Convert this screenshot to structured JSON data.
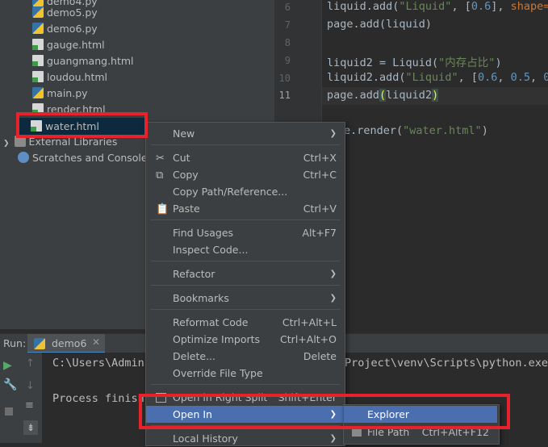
{
  "tree": {
    "items": [
      {
        "label": "demo4.py",
        "icon": "python-file-icon"
      },
      {
        "label": "demo5.py",
        "icon": "python-file-icon"
      },
      {
        "label": "demo6.py",
        "icon": "python-file-icon"
      },
      {
        "label": "gauge.html",
        "icon": "html-file-icon"
      },
      {
        "label": "guangmang.html",
        "icon": "html-file-icon"
      },
      {
        "label": "loudou.html",
        "icon": "html-file-icon"
      },
      {
        "label": "main.py",
        "icon": "python-file-icon"
      },
      {
        "label": "render.html",
        "icon": "html-file-icon"
      },
      {
        "label": "water.html",
        "icon": "html-file-icon"
      }
    ],
    "external_libraries": "External Libraries",
    "scratches": "Scratches and Consoles"
  },
  "editor": {
    "line_numbers": [
      "6",
      "7",
      "8",
      "9",
      "10",
      "11"
    ],
    "current_line": "11",
    "code": {
      "l6a": "liquid.add(",
      "l6s": "\"Liquid\"",
      "l6b": ", [",
      "l6n": "0.6",
      "l6c": "], ",
      "l6k": "shape=",
      "l7": "page.add(liquid)",
      "l9a": "liquid2 = Liquid(",
      "l9s": "\"内存占比\"",
      "l9b": ")",
      "l10a": "liquid2.add(",
      "l10s": "\"Liquid\"",
      "l10b": ", [",
      "l10n1": "0.6",
      "l10c": ", ",
      "l10n2": "0.5",
      "l10d": ", ",
      "l10n3": "0",
      "l11a": "page.add",
      "l11p": "(",
      "l11b": "liquid2",
      "l11q": ")",
      "l13a": "e.render(",
      "l13s": "\"water.html\"",
      "l13b": ")"
    }
  },
  "run": {
    "label": "Run:",
    "tab": "demo6",
    "line1_left": "C:\\Users\\Admin",
    "line1_right": "Project\\venv\\Scripts\\python.exe",
    "line2": "Process finish"
  },
  "context_menu": {
    "items": [
      {
        "label": "New",
        "shortcut": "",
        "submenu": true
      },
      {
        "label": "Cut",
        "shortcut": "Ctrl+X",
        "icon": "scissors-icon"
      },
      {
        "label": "Copy",
        "shortcut": "Ctrl+C",
        "icon": "copy-icon"
      },
      {
        "label": "Copy Path/Reference...",
        "shortcut": ""
      },
      {
        "label": "Paste",
        "shortcut": "Ctrl+V",
        "icon": "paste-icon"
      },
      {
        "label": "Find Usages",
        "shortcut": "Alt+F7"
      },
      {
        "label": "Inspect Code...",
        "shortcut": ""
      },
      {
        "label": "Refactor",
        "shortcut": "",
        "submenu": true
      },
      {
        "label": "Bookmarks",
        "shortcut": "",
        "submenu": true
      },
      {
        "label": "Reformat Code",
        "shortcut": "Ctrl+Alt+L"
      },
      {
        "label": "Optimize Imports",
        "shortcut": "Ctrl+Alt+O"
      },
      {
        "label": "Delete...",
        "shortcut": "Delete"
      },
      {
        "label": "Override File Type",
        "shortcut": ""
      },
      {
        "label": "Open in Right Split",
        "shortcut": "Shift+Enter"
      },
      {
        "label": "Open In",
        "shortcut": "",
        "submenu": true,
        "highlighted": true
      },
      {
        "label": "Local History",
        "shortcut": "",
        "submenu": true
      }
    ]
  },
  "submenu": {
    "items": [
      {
        "label": "Explorer",
        "highlighted": true
      },
      {
        "label": "File Path",
        "shortcut": "Ctrl+Alt+F12"
      }
    ]
  },
  "colors": {
    "highlight": "#4b6eaf",
    "annotation_red": "#e8222a",
    "selection": "#0d293e"
  }
}
